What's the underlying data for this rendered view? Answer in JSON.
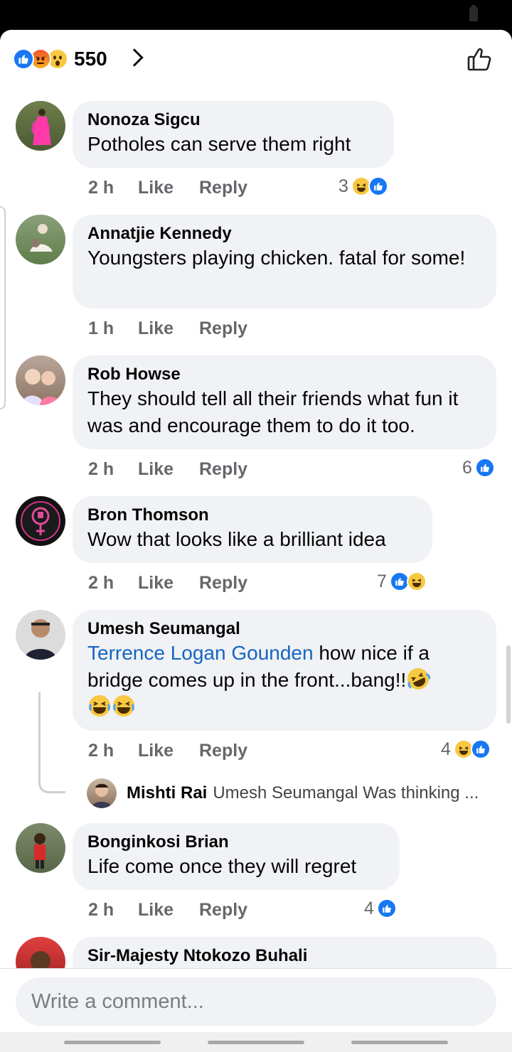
{
  "header": {
    "reaction_count": "550",
    "reactions": [
      "like-icon",
      "angry-icon",
      "wow-icon"
    ]
  },
  "comments": [
    {
      "author": "Nonoza Sigcu",
      "text": "Potholes can serve them right",
      "time": "2 h",
      "like": "Like",
      "reply": "Reply",
      "reaction_count": "3",
      "reactions": [
        "haha",
        "like"
      ]
    },
    {
      "author": "Annatjie Kennedy",
      "text": "Youngsters playing chicken.   fatal for some!",
      "time": "1 h",
      "like": "Like",
      "reply": "Reply"
    },
    {
      "author": "Rob Howse",
      "text": "They should tell all their friends what fun it was and encourage them to do it too.",
      "time": "2 h",
      "like": "Like",
      "reply": "Reply",
      "reaction_count": "6",
      "reactions": [
        "like"
      ]
    },
    {
      "author": "Bron Thomson",
      "text": "Wow that looks like a brilliant idea",
      "time": "2 h",
      "like": "Like",
      "reply": "Reply",
      "reaction_count": "7",
      "reactions": [
        "like",
        "haha"
      ]
    },
    {
      "author": "Umesh Seumangal",
      "mention": "Terrence Logan Gounden",
      "text": " how nice if a bridge comes up in the front...bang!!",
      "time": "2 h",
      "like": "Like",
      "reply": "Reply",
      "reaction_count": "4",
      "reactions": [
        "haha",
        "like"
      ]
    },
    {
      "author": "Bonginkosi Brian",
      "text": "Life come once they will regret",
      "time": "2 h",
      "like": "Like",
      "reply": "Reply",
      "reaction_count": "4",
      "reactions": [
        "like"
      ]
    },
    {
      "author": "Sir-Majesty Ntokozo Buhali"
    }
  ],
  "reply_preview": {
    "author": "Mishti Rai",
    "text": "Umesh Seumangal Was thinking ..."
  },
  "composer": {
    "placeholder": "Write a comment..."
  },
  "colors": {
    "like_blue": "#1877f2",
    "bubble_grey": "#f0f2f5",
    "mention_blue": "#1565c0",
    "meta_grey": "#65676b"
  }
}
